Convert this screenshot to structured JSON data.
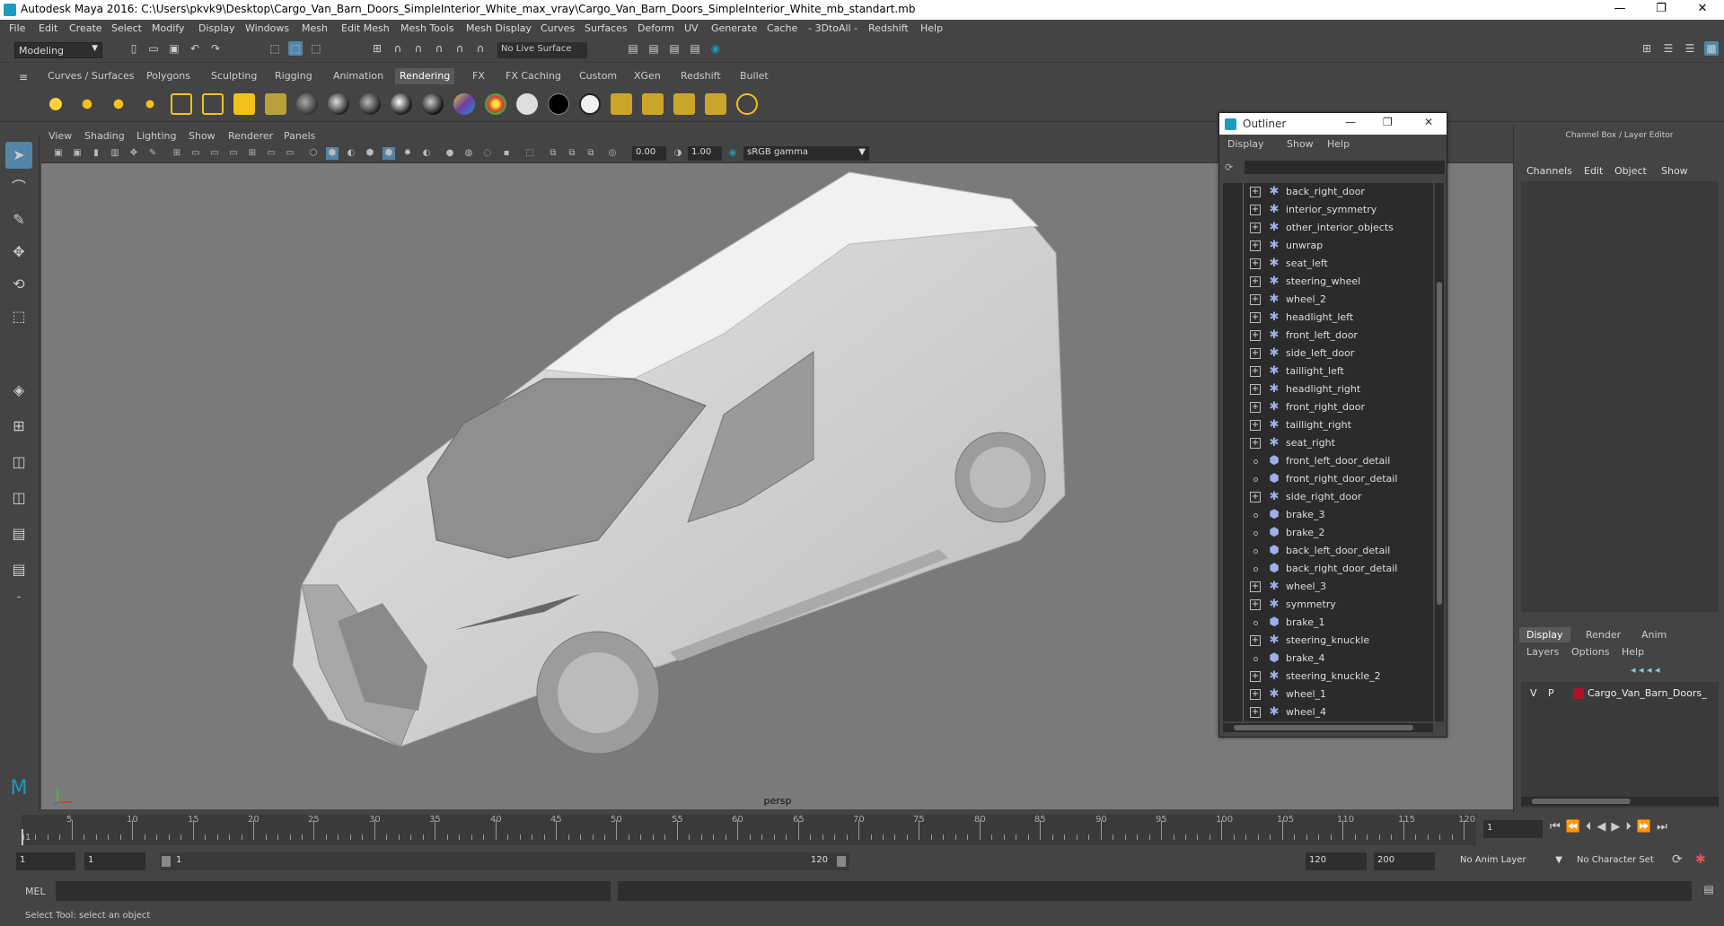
{
  "window": {
    "title": "Autodesk Maya 2016: C:\\Users\\pkvk9\\Desktop\\Cargo_Van_Barn_Doors_SimpleInterior_White_max_vray\\Cargo_Van_Barn_Doors_SimpleInterior_White_mb_standart.mb",
    "minimize": "—",
    "maximize": "❐",
    "close": "✕"
  },
  "menubar": [
    "File",
    "Edit",
    "Create",
    "Select",
    "Modify",
    "Display",
    "Windows",
    "Mesh",
    "Edit Mesh",
    "Mesh Tools",
    "Mesh Display",
    "Curves",
    "Surfaces",
    "Deform",
    "UV",
    "Generate",
    "Cache",
    "- 3DtoAll -",
    "Redshift",
    "Help"
  ],
  "status_line": {
    "mode": "Modeling",
    "live_surface": "No Live Surface"
  },
  "shelf_tabs": [
    "Curves / Surfaces",
    "Polygons",
    "Sculpting",
    "Rigging",
    "Animation",
    "Rendering",
    "FX",
    "FX Caching",
    "Custom",
    "XGen",
    "Redshift",
    "Bullet"
  ],
  "shelf_active": "Rendering",
  "viewport": {
    "menu": [
      "View",
      "Shading",
      "Lighting",
      "Show",
      "Renderer",
      "Panels"
    ],
    "field_a": "0.00",
    "field_b": "1.00",
    "color_space": "sRGB gamma",
    "camera_label": "persp"
  },
  "outliner": {
    "title": "Outliner",
    "menu": [
      "Display",
      "Show",
      "Help"
    ],
    "items": [
      {
        "name": "back_right_door",
        "type": "group"
      },
      {
        "name": "interior_symmetry",
        "type": "group"
      },
      {
        "name": "other_interior_objects",
        "type": "group"
      },
      {
        "name": "unwrap",
        "type": "group"
      },
      {
        "name": "seat_left",
        "type": "group"
      },
      {
        "name": "steering_wheel",
        "type": "group"
      },
      {
        "name": "wheel_2",
        "type": "group"
      },
      {
        "name": "headlight_left",
        "type": "group"
      },
      {
        "name": "front_left_door",
        "type": "group"
      },
      {
        "name": "side_left_door",
        "type": "group"
      },
      {
        "name": "taillight_left",
        "type": "group"
      },
      {
        "name": "headlight_right",
        "type": "group"
      },
      {
        "name": "front_right_door",
        "type": "group"
      },
      {
        "name": "taillight_right",
        "type": "group"
      },
      {
        "name": "seat_right",
        "type": "group"
      },
      {
        "name": "front_left_door_detail",
        "type": "mesh"
      },
      {
        "name": "front_right_door_detail",
        "type": "mesh"
      },
      {
        "name": "side_right_door",
        "type": "group"
      },
      {
        "name": "brake_3",
        "type": "mesh"
      },
      {
        "name": "brake_2",
        "type": "mesh"
      },
      {
        "name": "back_left_door_detail",
        "type": "mesh"
      },
      {
        "name": "back_right_door_detail",
        "type": "mesh"
      },
      {
        "name": "wheel_3",
        "type": "group"
      },
      {
        "name": "symmetry",
        "type": "group"
      },
      {
        "name": "brake_1",
        "type": "mesh"
      },
      {
        "name": "steering_knuckle",
        "type": "group"
      },
      {
        "name": "brake_4",
        "type": "mesh"
      },
      {
        "name": "steering_knuckle_2",
        "type": "group"
      },
      {
        "name": "wheel_1",
        "type": "group"
      },
      {
        "name": "wheel_4",
        "type": "group"
      }
    ]
  },
  "channel_box": {
    "header": "Channel Box / Layer Editor",
    "menu": [
      "Channels",
      "Edit",
      "Object",
      "Show"
    ],
    "layer_tabs": [
      "Display",
      "Render",
      "Anim"
    ],
    "layer_tab_active": "Display",
    "layer_menu": [
      "Layers",
      "Options",
      "Help"
    ],
    "layer": {
      "v": "V",
      "p": "P",
      "name": "Cargo_Van_Barn_Doors_",
      "color": "#b0102a"
    }
  },
  "timeline": {
    "ticks": [
      5,
      10,
      15,
      20,
      25,
      30,
      35,
      40,
      45,
      50,
      55,
      60,
      65,
      70,
      75,
      80,
      85,
      90,
      95,
      100,
      105,
      110,
      115,
      120
    ],
    "start_tick": "1",
    "current_frame": "1"
  },
  "range": {
    "start": "1",
    "playback_start": "1",
    "slider_start": "1",
    "slider_end": "120",
    "playback_end": "120",
    "end": "200",
    "anim_layer": "No Anim Layer",
    "character_set": "No Character Set"
  },
  "command": {
    "label": "MEL"
  },
  "help_line": "Select Tool: select an object",
  "colors": {
    "accent": "#5285a6",
    "maya_blue": "#1a9bbf",
    "layer_red": "#b0102a"
  }
}
